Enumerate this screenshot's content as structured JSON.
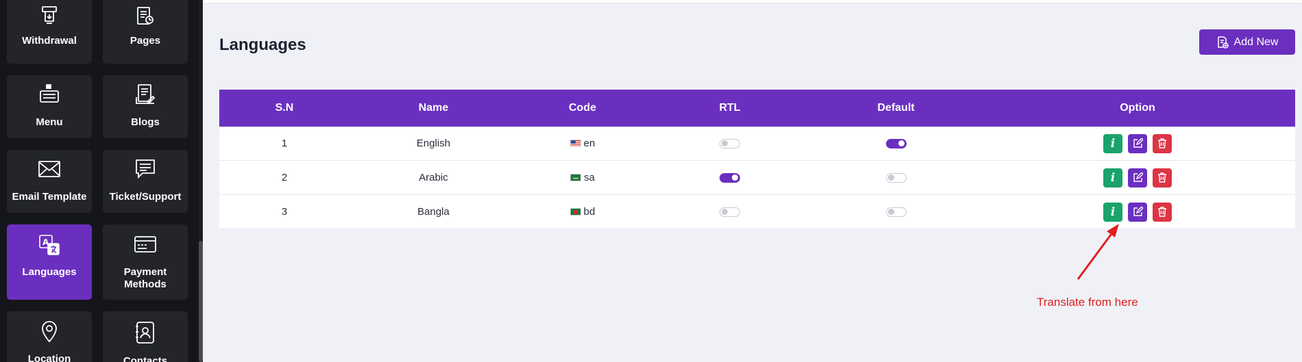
{
  "sidebar": {
    "tiles": [
      {
        "label": "Withdrawal",
        "icon": "atm-withdraw-icon"
      },
      {
        "label": "Pages",
        "icon": "pages-icon"
      },
      {
        "label": "Menu",
        "icon": "menu-icon"
      },
      {
        "label": "Blogs",
        "icon": "blogs-icon"
      },
      {
        "label": "Email Template",
        "icon": "envelope-icon"
      },
      {
        "label": "Ticket/Support",
        "icon": "chat-icon"
      },
      {
        "label": "Languages",
        "icon": "translate-icon",
        "active": true
      },
      {
        "label": "Payment Methods",
        "icon": "payment-card-icon"
      },
      {
        "label": "Location",
        "icon": "location-pin-icon"
      },
      {
        "label": "Contacts",
        "icon": "contacts-book-icon"
      }
    ]
  },
  "main": {
    "title": "Languages",
    "add_button": "Add New",
    "table": {
      "headers": [
        "S.N",
        "Name",
        "Code",
        "RTL",
        "Default",
        "Option"
      ],
      "rows": [
        {
          "sn": "1",
          "name": "English",
          "code": "en",
          "flag": "us",
          "rtl": false,
          "default": true
        },
        {
          "sn": "2",
          "name": "Arabic",
          "code": "sa",
          "flag": "sa",
          "rtl": true,
          "default": false
        },
        {
          "sn": "3",
          "name": "Bangla",
          "code": "bd",
          "flag": "bd",
          "rtl": false,
          "default": false
        }
      ]
    }
  },
  "annotation": {
    "text": "Translate from here",
    "color": "#e02020"
  },
  "colors": {
    "accent": "#6b2fc0",
    "success": "#1aa36a",
    "danger": "#dc3545",
    "sidebar_bg": "#15161b",
    "tile_bg": "#23252b"
  }
}
